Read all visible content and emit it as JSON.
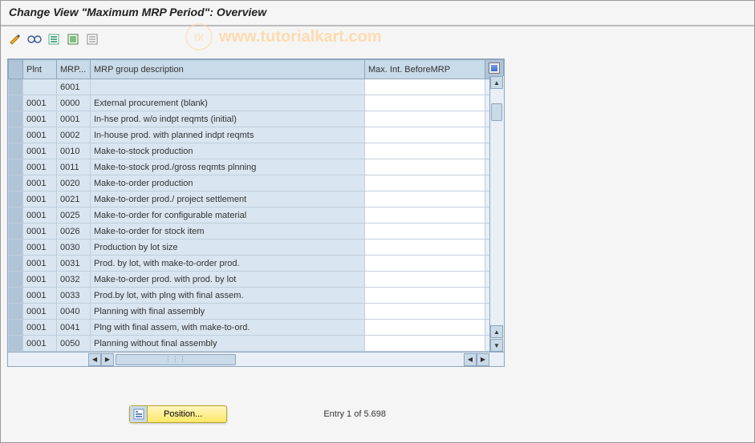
{
  "title": "Change View \"Maximum MRP Period\": Overview",
  "watermark": "www.tutorialkart.com",
  "toolbar": {
    "btn1": "display-change-icon",
    "btn2": "glasses-icon",
    "btn3": "select-all-icon",
    "btn4": "select-block-icon",
    "btn5": "deselect-icon"
  },
  "columns": {
    "plnt": "Plnt",
    "mrp": "MRP...",
    "desc": "MRP group description",
    "max": "Max. Int. BeforeMRP"
  },
  "rows": [
    {
      "plnt": "",
      "mrp": "6001",
      "desc": "",
      "max": ""
    },
    {
      "plnt": "0001",
      "mrp": "0000",
      "desc": "External procurement              (blank)",
      "max": ""
    },
    {
      "plnt": "0001",
      "mrp": "0001",
      "desc": "In-hse prod. w/o indpt reqmts (initial)",
      "max": ""
    },
    {
      "plnt": "0001",
      "mrp": "0002",
      "desc": "In-house prod. with planned indpt reqmts",
      "max": ""
    },
    {
      "plnt": "0001",
      "mrp": "0010",
      "desc": "Make-to-stock production",
      "max": ""
    },
    {
      "plnt": "0001",
      "mrp": "0011",
      "desc": "Make-to-stock prod./gross reqmts plnning",
      "max": ""
    },
    {
      "plnt": "0001",
      "mrp": "0020",
      "desc": "Make-to-order production",
      "max": ""
    },
    {
      "plnt": "0001",
      "mrp": "0021",
      "desc": "Make-to-order prod./ project settlement",
      "max": ""
    },
    {
      "plnt": "0001",
      "mrp": "0025",
      "desc": "Make-to-order for configurable material",
      "max": ""
    },
    {
      "plnt": "0001",
      "mrp": "0026",
      "desc": "Make-to-order for stock item",
      "max": ""
    },
    {
      "plnt": "0001",
      "mrp": "0030",
      "desc": "Production by lot size",
      "max": ""
    },
    {
      "plnt": "0001",
      "mrp": "0031",
      "desc": "Prod. by lot, with make-to-order prod.",
      "max": ""
    },
    {
      "plnt": "0001",
      "mrp": "0032",
      "desc": "Make-to-order prod. with prod. by lot",
      "max": ""
    },
    {
      "plnt": "0001",
      "mrp": "0033",
      "desc": "Prod.by lot, with plng with final assem.",
      "max": ""
    },
    {
      "plnt": "0001",
      "mrp": "0040",
      "desc": "Planning with final assembly",
      "max": ""
    },
    {
      "plnt": "0001",
      "mrp": "0041",
      "desc": "Plng with final assem, with make-to-ord.",
      "max": ""
    },
    {
      "plnt": "0001",
      "mrp": "0050",
      "desc": "Planning without final assembly",
      "max": ""
    }
  ],
  "footer": {
    "position_label": "Position...",
    "entry_text": "Entry 1 of 5.698"
  }
}
